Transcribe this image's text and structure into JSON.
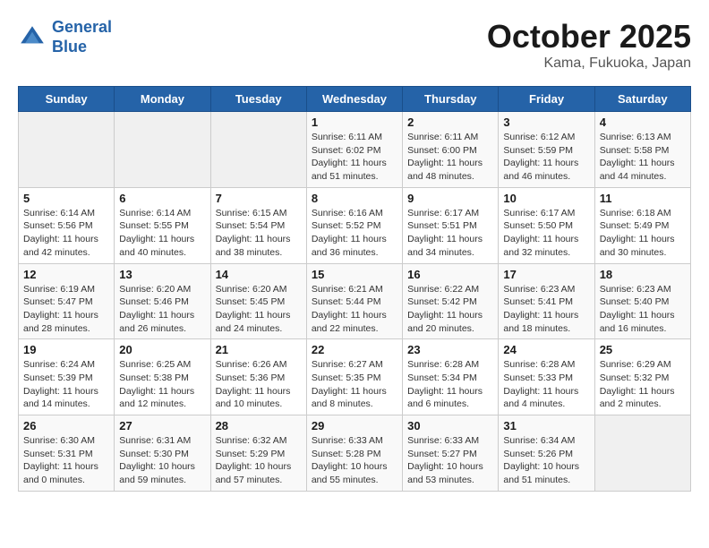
{
  "header": {
    "logo_line1": "General",
    "logo_line2": "Blue",
    "month": "October 2025",
    "location": "Kama, Fukuoka, Japan"
  },
  "weekdays": [
    "Sunday",
    "Monday",
    "Tuesday",
    "Wednesday",
    "Thursday",
    "Friday",
    "Saturday"
  ],
  "weeks": [
    [
      {
        "day": "",
        "info": ""
      },
      {
        "day": "",
        "info": ""
      },
      {
        "day": "",
        "info": ""
      },
      {
        "day": "1",
        "info": "Sunrise: 6:11 AM\nSunset: 6:02 PM\nDaylight: 11 hours\nand 51 minutes."
      },
      {
        "day": "2",
        "info": "Sunrise: 6:11 AM\nSunset: 6:00 PM\nDaylight: 11 hours\nand 48 minutes."
      },
      {
        "day": "3",
        "info": "Sunrise: 6:12 AM\nSunset: 5:59 PM\nDaylight: 11 hours\nand 46 minutes."
      },
      {
        "day": "4",
        "info": "Sunrise: 6:13 AM\nSunset: 5:58 PM\nDaylight: 11 hours\nand 44 minutes."
      }
    ],
    [
      {
        "day": "5",
        "info": "Sunrise: 6:14 AM\nSunset: 5:56 PM\nDaylight: 11 hours\nand 42 minutes."
      },
      {
        "day": "6",
        "info": "Sunrise: 6:14 AM\nSunset: 5:55 PM\nDaylight: 11 hours\nand 40 minutes."
      },
      {
        "day": "7",
        "info": "Sunrise: 6:15 AM\nSunset: 5:54 PM\nDaylight: 11 hours\nand 38 minutes."
      },
      {
        "day": "8",
        "info": "Sunrise: 6:16 AM\nSunset: 5:52 PM\nDaylight: 11 hours\nand 36 minutes."
      },
      {
        "day": "9",
        "info": "Sunrise: 6:17 AM\nSunset: 5:51 PM\nDaylight: 11 hours\nand 34 minutes."
      },
      {
        "day": "10",
        "info": "Sunrise: 6:17 AM\nSunset: 5:50 PM\nDaylight: 11 hours\nand 32 minutes."
      },
      {
        "day": "11",
        "info": "Sunrise: 6:18 AM\nSunset: 5:49 PM\nDaylight: 11 hours\nand 30 minutes."
      }
    ],
    [
      {
        "day": "12",
        "info": "Sunrise: 6:19 AM\nSunset: 5:47 PM\nDaylight: 11 hours\nand 28 minutes."
      },
      {
        "day": "13",
        "info": "Sunrise: 6:20 AM\nSunset: 5:46 PM\nDaylight: 11 hours\nand 26 minutes."
      },
      {
        "day": "14",
        "info": "Sunrise: 6:20 AM\nSunset: 5:45 PM\nDaylight: 11 hours\nand 24 minutes."
      },
      {
        "day": "15",
        "info": "Sunrise: 6:21 AM\nSunset: 5:44 PM\nDaylight: 11 hours\nand 22 minutes."
      },
      {
        "day": "16",
        "info": "Sunrise: 6:22 AM\nSunset: 5:42 PM\nDaylight: 11 hours\nand 20 minutes."
      },
      {
        "day": "17",
        "info": "Sunrise: 6:23 AM\nSunset: 5:41 PM\nDaylight: 11 hours\nand 18 minutes."
      },
      {
        "day": "18",
        "info": "Sunrise: 6:23 AM\nSunset: 5:40 PM\nDaylight: 11 hours\nand 16 minutes."
      }
    ],
    [
      {
        "day": "19",
        "info": "Sunrise: 6:24 AM\nSunset: 5:39 PM\nDaylight: 11 hours\nand 14 minutes."
      },
      {
        "day": "20",
        "info": "Sunrise: 6:25 AM\nSunset: 5:38 PM\nDaylight: 11 hours\nand 12 minutes."
      },
      {
        "day": "21",
        "info": "Sunrise: 6:26 AM\nSunset: 5:36 PM\nDaylight: 11 hours\nand 10 minutes."
      },
      {
        "day": "22",
        "info": "Sunrise: 6:27 AM\nSunset: 5:35 PM\nDaylight: 11 hours\nand 8 minutes."
      },
      {
        "day": "23",
        "info": "Sunrise: 6:28 AM\nSunset: 5:34 PM\nDaylight: 11 hours\nand 6 minutes."
      },
      {
        "day": "24",
        "info": "Sunrise: 6:28 AM\nSunset: 5:33 PM\nDaylight: 11 hours\nand 4 minutes."
      },
      {
        "day": "25",
        "info": "Sunrise: 6:29 AM\nSunset: 5:32 PM\nDaylight: 11 hours\nand 2 minutes."
      }
    ],
    [
      {
        "day": "26",
        "info": "Sunrise: 6:30 AM\nSunset: 5:31 PM\nDaylight: 11 hours\nand 0 minutes."
      },
      {
        "day": "27",
        "info": "Sunrise: 6:31 AM\nSunset: 5:30 PM\nDaylight: 10 hours\nand 59 minutes."
      },
      {
        "day": "28",
        "info": "Sunrise: 6:32 AM\nSunset: 5:29 PM\nDaylight: 10 hours\nand 57 minutes."
      },
      {
        "day": "29",
        "info": "Sunrise: 6:33 AM\nSunset: 5:28 PM\nDaylight: 10 hours\nand 55 minutes."
      },
      {
        "day": "30",
        "info": "Sunrise: 6:33 AM\nSunset: 5:27 PM\nDaylight: 10 hours\nand 53 minutes."
      },
      {
        "day": "31",
        "info": "Sunrise: 6:34 AM\nSunset: 5:26 PM\nDaylight: 10 hours\nand 51 minutes."
      },
      {
        "day": "",
        "info": ""
      }
    ]
  ]
}
